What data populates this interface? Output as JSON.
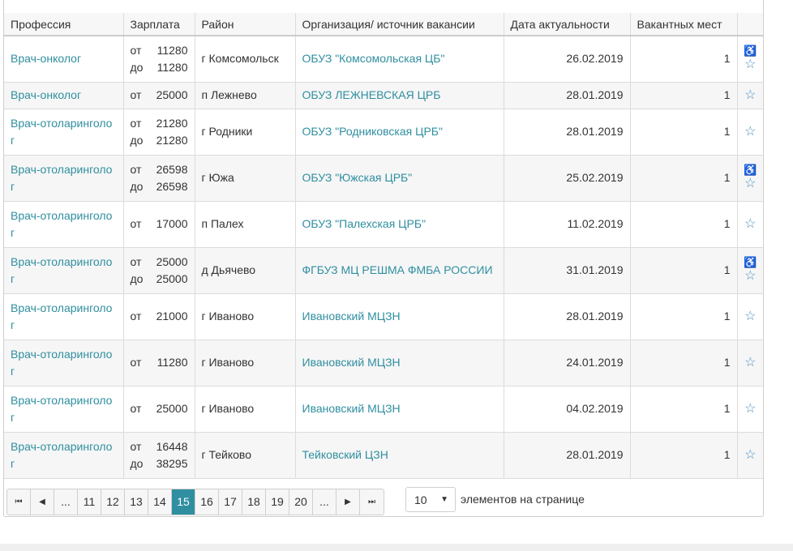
{
  "columns": [
    "Профессия",
    "Зарплата",
    "Район",
    "Организация/ источник вакансии",
    "Дата актуальности",
    "Вакантных мест"
  ],
  "salary_prefix": {
    "from": "от",
    "to": "до"
  },
  "rows": [
    {
      "profession": "Врач-онколог",
      "salary_from": "11280",
      "salary_to": "11280",
      "district": "г Комсомольск",
      "organization": "ОБУЗ \"Комсомольская ЦБ\"",
      "date": "26.02.2019",
      "vacancies": "1",
      "accessible": true
    },
    {
      "profession": "Врач-онколог",
      "salary_from": "25000",
      "salary_to": "",
      "district": "п Лежнево",
      "organization": "ОБУЗ ЛЕЖНЕВСКАЯ ЦРБ",
      "date": "28.01.2019",
      "vacancies": "1",
      "accessible": false
    },
    {
      "profession": "Врач-отоларинголог",
      "salary_from": "21280",
      "salary_to": "21280",
      "district": "г Родники",
      "organization": "ОБУЗ \"Родниковская ЦРБ\"",
      "date": "28.01.2019",
      "vacancies": "1",
      "accessible": false
    },
    {
      "profession": "Врач-отоларинголог",
      "salary_from": "26598",
      "salary_to": "26598",
      "district": "г Южа",
      "organization": "ОБУЗ \"Южская ЦРБ\"",
      "date": "25.02.2019",
      "vacancies": "1",
      "accessible": true
    },
    {
      "profession": "Врач-отоларинголог",
      "salary_from": "17000",
      "salary_to": "",
      "district": "п Палех",
      "organization": "ОБУЗ \"Палехская ЦРБ\"",
      "date": "11.02.2019",
      "vacancies": "1",
      "accessible": false
    },
    {
      "profession": "Врач-отоларинголог",
      "salary_from": "25000",
      "salary_to": "25000",
      "district": "д Дьячево",
      "organization": "ФГБУЗ МЦ РЕШМА ФМБА РОССИИ",
      "date": "31.01.2019",
      "vacancies": "1",
      "accessible": true
    },
    {
      "profession": "Врач-отоларинголог",
      "salary_from": "21000",
      "salary_to": "",
      "district": "г Иваново",
      "organization": "Ивановский МЦЗН",
      "date": "28.01.2019",
      "vacancies": "1",
      "accessible": false
    },
    {
      "profession": "Врач-отоларинголог",
      "salary_from": "11280",
      "salary_to": "",
      "district": "г Иваново",
      "organization": "Ивановский МЦЗН",
      "date": "24.01.2019",
      "vacancies": "1",
      "accessible": false
    },
    {
      "profession": "Врач-отоларинголог",
      "salary_from": "25000",
      "salary_to": "",
      "district": "г Иваново",
      "organization": "Ивановский МЦЗН",
      "date": "04.02.2019",
      "vacancies": "1",
      "accessible": false
    },
    {
      "profession": "Врач-отоларинголог",
      "salary_from": "16448",
      "salary_to": "38295",
      "district": "г Тейково",
      "organization": "Тейковский ЦЗН",
      "date": "28.01.2019",
      "vacancies": "1",
      "accessible": false
    }
  ],
  "pager": {
    "first": "⏮",
    "prev": "◀",
    "ellipsis": "...",
    "pages": [
      "11",
      "12",
      "13",
      "14",
      "15",
      "16",
      "17",
      "18",
      "19",
      "20"
    ],
    "current": "15",
    "next": "▶",
    "last": "⏭"
  },
  "page_size": {
    "value": "10",
    "label": "элементов на странице"
  },
  "icons": {
    "favorite": "star-outline",
    "accessible": "wheelchair"
  },
  "colors": {
    "link": "#2f8fa0",
    "active_page": "#2f8fa0",
    "icon": "#4a8fbf"
  }
}
